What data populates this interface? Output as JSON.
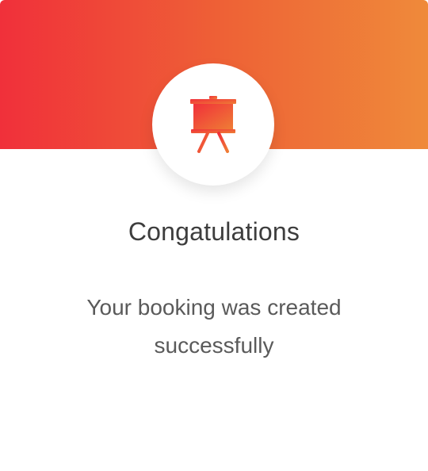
{
  "dialog": {
    "title": "Congatulations",
    "message": "Your booking was created successfully",
    "icon": "easel-presentation-icon"
  },
  "colors": {
    "gradient_start": "#f0303a",
    "gradient_mid": "#ee6436",
    "gradient_end": "#ef8a3a",
    "title_text": "#3d3d3d",
    "body_text": "#5a5a5a",
    "background": "#ffffff"
  }
}
